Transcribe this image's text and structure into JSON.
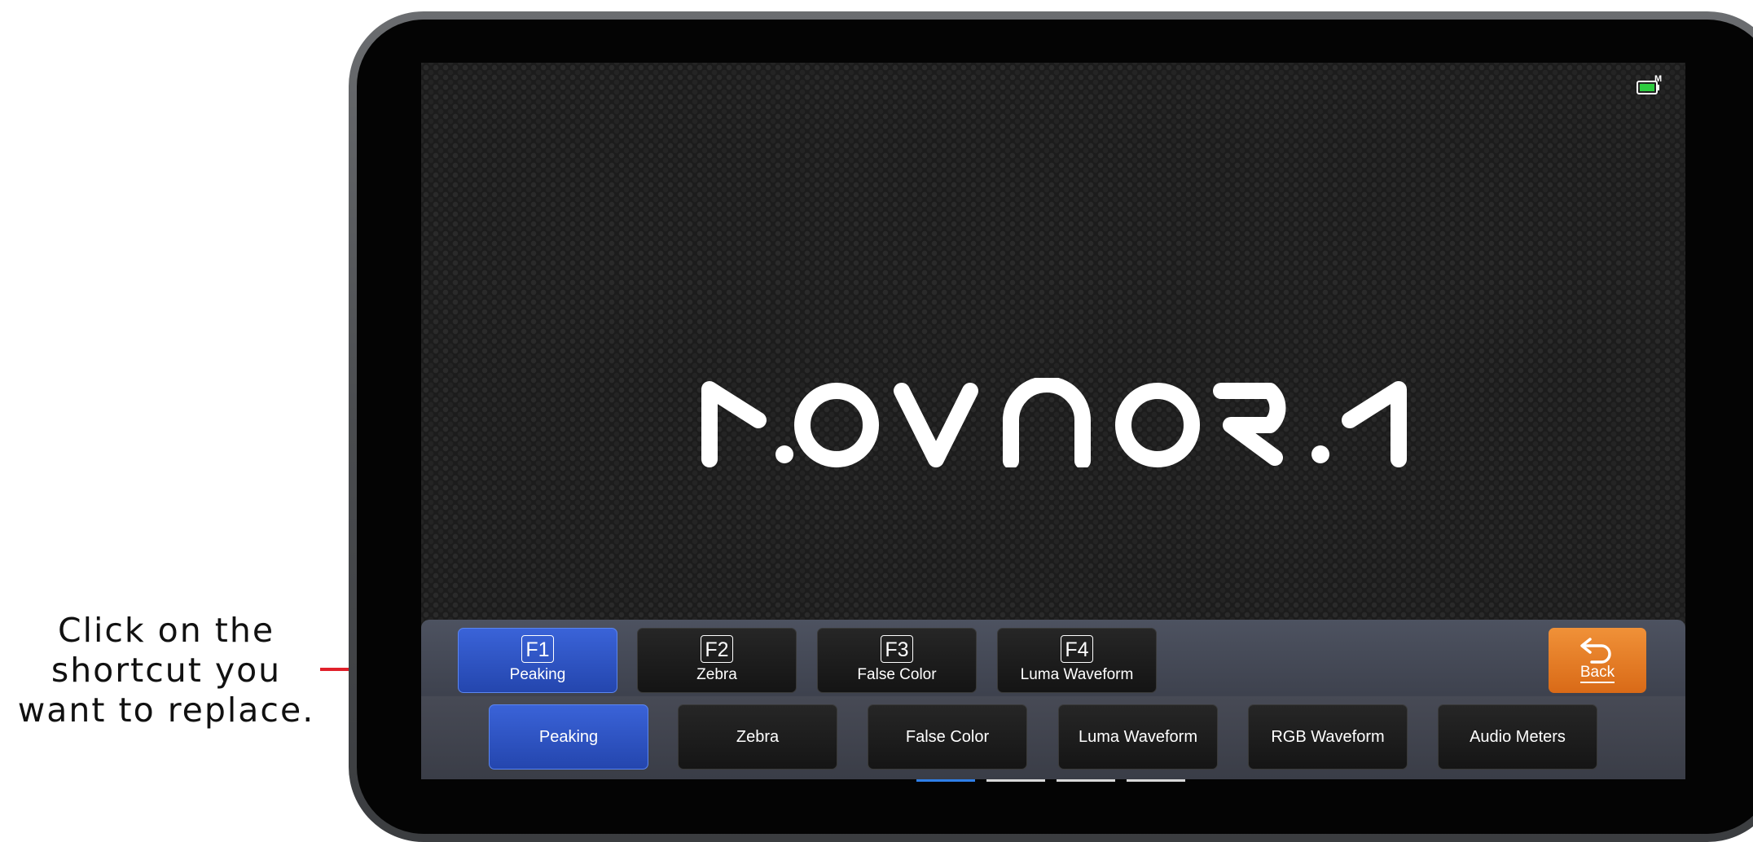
{
  "annotation": {
    "line1": "Click on the",
    "line2": "shortcut you",
    "line3": "want to replace."
  },
  "device": {
    "brand_logo": "MOVNORM",
    "battery_icon": "battery-icon",
    "battery_badge": "M",
    "battery_color": "#2ecc40"
  },
  "shortcut_bar": {
    "keys": [
      {
        "key": "F1",
        "label": "Peaking",
        "active": true
      },
      {
        "key": "F2",
        "label": "Zebra",
        "active": false
      },
      {
        "key": "F3",
        "label": "False Color",
        "active": false
      },
      {
        "key": "F4",
        "label": "Luma Waveform",
        "active": false
      }
    ],
    "back_label": "Back",
    "back_icon": "return-arrow-icon",
    "back_color": "#e97d24"
  },
  "options_bar": {
    "options": [
      "Peaking",
      "Zebra",
      "False Color",
      "Luma Waveform",
      "RGB Waveform",
      "Audio Meters"
    ],
    "active_index": 0,
    "page_indicator": {
      "count": 4,
      "active": 0
    }
  },
  "colors": {
    "active_blue": "#2f56c6",
    "annotation_red": "#e0202a"
  }
}
